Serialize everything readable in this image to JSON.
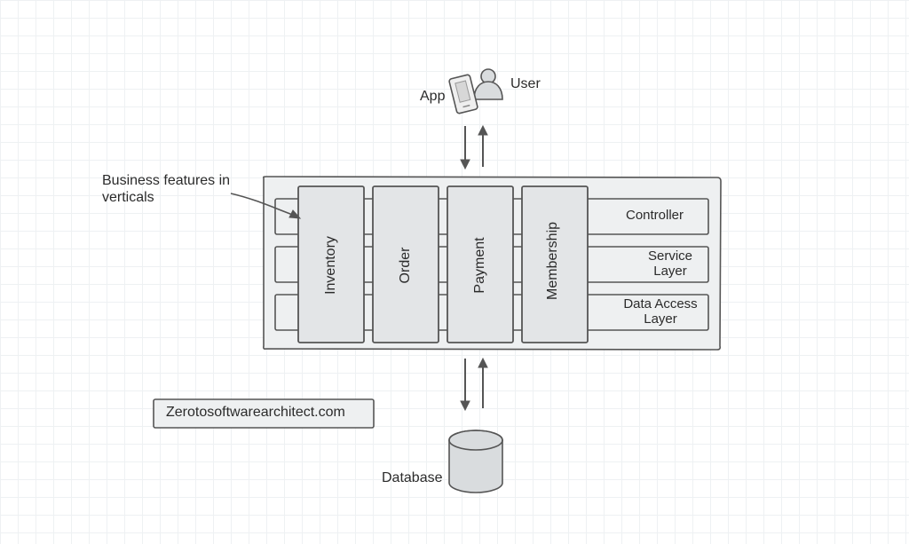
{
  "diagram": {
    "user_label": "User",
    "app_label": "App",
    "annotation": "Business features in verticals",
    "verticals": {
      "inventory": "Inventory",
      "order": "Order",
      "payment": "Payment",
      "membership": "Membership"
    },
    "layers": {
      "controller": "Controller",
      "service": "Service Layer",
      "data_access": "Data Access Layer"
    },
    "database_label": "Database",
    "watermark": "Zerotosoftwarearchitect.com"
  }
}
